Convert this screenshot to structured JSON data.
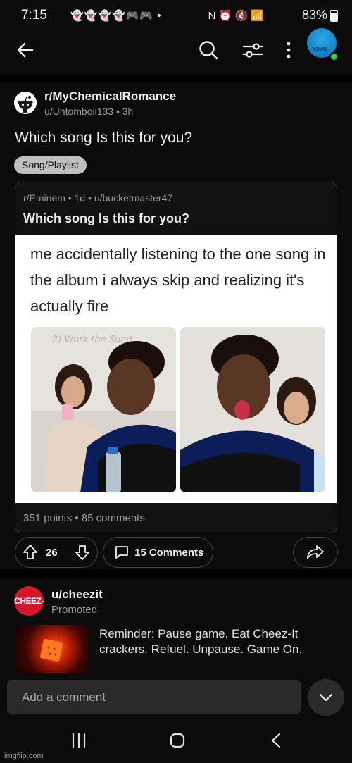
{
  "status_bar": {
    "time": "7:15",
    "notification_icons": "👻👻👻👻🎮🎮 •",
    "battery": "83%",
    "right_icons": "N ⏰ 🔇 📶"
  },
  "top_bar": {
    "back_icon": "arrow-left-icon",
    "search_icon": "search-icon",
    "filter_icon": "sliders-icon",
    "more_icon": "more-vertical-icon",
    "avatar_label": "YOUR"
  },
  "post": {
    "subreddit": "r/MyChemicalRomance",
    "meta": "u/Uhtomboii133 • 3h",
    "title": "Which song Is this for you?",
    "flair": "Song/Playlist"
  },
  "crosspost": {
    "meta": "r/Eminem • 1d • u/bucketmaster47",
    "title": "Which song Is this for you?",
    "meme_text": "me accidentally listening to the one song in the album i always skip and realizing it's actually fire",
    "meme_whiteboard_text": "2) Work the Sund",
    "footer": "351 points • 85 comments"
  },
  "actions": {
    "vote_count": "26",
    "comments_label": "15 Comments"
  },
  "ad": {
    "logo_text": "CHEEZ-IT",
    "user": "u/cheezit",
    "promoted": "Promoted",
    "text": "Reminder: Pause game. Eat Cheez-It crackers. Refuel. Unpause. Game On."
  },
  "comment_bar": {
    "placeholder": "Add a comment"
  },
  "watermark": "imgflip.com",
  "colors": {
    "background": "#0b0b0b",
    "online": "#2bd34a",
    "cheezit_red": "#d2172a"
  }
}
